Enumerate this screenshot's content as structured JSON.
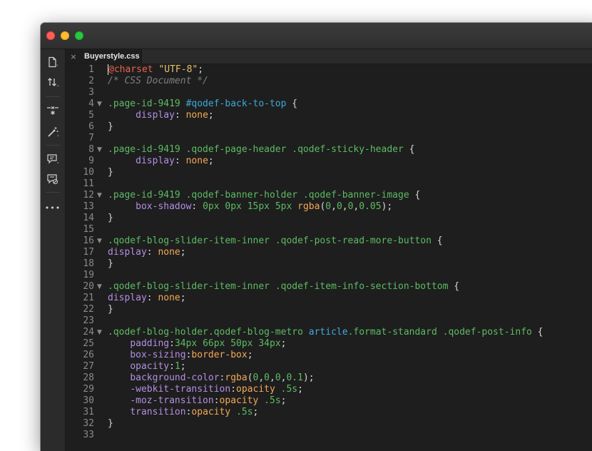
{
  "window": {
    "title": ""
  },
  "tabs": [
    {
      "label": "Buyerstyle.css",
      "active": true,
      "close_glyph": "×"
    }
  ],
  "toolbar": {
    "tools": [
      {
        "icon": "new-file-icon",
        "label": ""
      },
      {
        "icon": "file-transfer-icon",
        "label": ""
      },
      {
        "icon": "asterisk-code-icon",
        "label": ""
      },
      {
        "icon": "magic-wand-icon",
        "label": ""
      },
      {
        "icon": "comment-icon",
        "label": ""
      },
      {
        "icon": "uncomment-icon",
        "label": ""
      },
      {
        "icon": "more-icon",
        "label": "•••"
      }
    ]
  },
  "editor": {
    "lines": [
      {
        "n": "1",
        "fold": false,
        "tokens": [
          [
            "t-at",
            "@charset"
          ],
          [
            "t-p",
            " "
          ],
          [
            "t-str",
            "\"UTF-8\""
          ],
          [
            "t-p",
            ";"
          ]
        ]
      },
      {
        "n": "2",
        "fold": false,
        "tokens": [
          [
            "t-com",
            "/* CSS Document */"
          ]
        ]
      },
      {
        "n": "3",
        "fold": false,
        "tokens": []
      },
      {
        "n": "4",
        "fold": true,
        "tokens": [
          [
            "t-sel",
            ".page-id-9419"
          ],
          [
            "t-p",
            " "
          ],
          [
            "t-id",
            "#qodef-back-to-top"
          ],
          [
            "t-p",
            " {"
          ]
        ]
      },
      {
        "n": "5",
        "fold": false,
        "tokens": [
          [
            "t-p",
            "     "
          ],
          [
            "t-prop",
            "display"
          ],
          [
            "t-p",
            ": "
          ],
          [
            "t-val",
            "none"
          ],
          [
            "t-p",
            ";"
          ]
        ]
      },
      {
        "n": "6",
        "fold": false,
        "tokens": [
          [
            "t-p",
            "}"
          ]
        ]
      },
      {
        "n": "7",
        "fold": false,
        "tokens": []
      },
      {
        "n": "8",
        "fold": true,
        "tokens": [
          [
            "t-sel",
            ".page-id-9419 .qodef-page-header .qodef-sticky-header"
          ],
          [
            "t-p",
            " {"
          ]
        ]
      },
      {
        "n": "9",
        "fold": false,
        "tokens": [
          [
            "t-p",
            "     "
          ],
          [
            "t-prop",
            "display"
          ],
          [
            "t-p",
            ": "
          ],
          [
            "t-val",
            "none"
          ],
          [
            "t-p",
            ";"
          ]
        ]
      },
      {
        "n": "10",
        "fold": false,
        "tokens": [
          [
            "t-p",
            "}"
          ]
        ]
      },
      {
        "n": "11",
        "fold": false,
        "tokens": []
      },
      {
        "n": "12",
        "fold": true,
        "tokens": [
          [
            "t-sel",
            ".page-id-9419 .qodef-banner-holder .qodef-banner-image"
          ],
          [
            "t-p",
            " {"
          ]
        ]
      },
      {
        "n": "13",
        "fold": false,
        "tokens": [
          [
            "t-p",
            "     "
          ],
          [
            "t-prop",
            "box-shadow"
          ],
          [
            "t-p",
            ": "
          ],
          [
            "t-num",
            "0px 0px 15px 5px"
          ],
          [
            "t-p",
            " "
          ],
          [
            "t-fn",
            "rgba"
          ],
          [
            "t-p",
            "("
          ],
          [
            "t-num",
            "0"
          ],
          [
            "t-p",
            ","
          ],
          [
            "t-num",
            "0"
          ],
          [
            "t-p",
            ","
          ],
          [
            "t-num",
            "0"
          ],
          [
            "t-p",
            ","
          ],
          [
            "t-num",
            "0.05"
          ],
          [
            "t-p",
            ");"
          ]
        ]
      },
      {
        "n": "14",
        "fold": false,
        "tokens": [
          [
            "t-p",
            "}"
          ]
        ]
      },
      {
        "n": "15",
        "fold": false,
        "tokens": []
      },
      {
        "n": "16",
        "fold": true,
        "tokens": [
          [
            "t-sel",
            ".qodef-blog-slider-item-inner .qodef-post-read-more-button"
          ],
          [
            "t-p",
            " {"
          ]
        ]
      },
      {
        "n": "17",
        "fold": false,
        "tokens": [
          [
            "t-prop",
            "display"
          ],
          [
            "t-p",
            ": "
          ],
          [
            "t-val",
            "none"
          ],
          [
            "t-p",
            ";"
          ]
        ]
      },
      {
        "n": "18",
        "fold": false,
        "tokens": [
          [
            "t-p",
            "}"
          ]
        ]
      },
      {
        "n": "19",
        "fold": false,
        "tokens": []
      },
      {
        "n": "20",
        "fold": true,
        "tokens": [
          [
            "t-sel",
            ".qodef-blog-slider-item-inner .qodef-item-info-section-bottom"
          ],
          [
            "t-p",
            " {"
          ]
        ]
      },
      {
        "n": "21",
        "fold": false,
        "tokens": [
          [
            "t-prop",
            "display"
          ],
          [
            "t-p",
            ": "
          ],
          [
            "t-val",
            "none"
          ],
          [
            "t-p",
            ";"
          ]
        ]
      },
      {
        "n": "22",
        "fold": false,
        "tokens": [
          [
            "t-p",
            "}"
          ]
        ]
      },
      {
        "n": "23",
        "fold": false,
        "tokens": []
      },
      {
        "n": "24",
        "fold": true,
        "tokens": [
          [
            "t-sel",
            ".qodef-blog-holder.qodef-blog-metro"
          ],
          [
            "t-p",
            " "
          ],
          [
            "t-tag",
            "article"
          ],
          [
            "t-sel",
            ".format-standard .qodef-post-info"
          ],
          [
            "t-p",
            " {"
          ]
        ]
      },
      {
        "n": "25",
        "fold": false,
        "tokens": [
          [
            "t-p",
            "    "
          ],
          [
            "t-prop",
            "padding"
          ],
          [
            "t-p",
            ":"
          ],
          [
            "t-num",
            "34px 66px 50px 34px"
          ],
          [
            "t-p",
            ";"
          ]
        ]
      },
      {
        "n": "26",
        "fold": false,
        "tokens": [
          [
            "t-p",
            "    "
          ],
          [
            "t-prop",
            "box-sizing"
          ],
          [
            "t-p",
            ":"
          ],
          [
            "t-val",
            "border-box"
          ],
          [
            "t-p",
            ";"
          ]
        ]
      },
      {
        "n": "27",
        "fold": false,
        "tokens": [
          [
            "t-p",
            "    "
          ],
          [
            "t-prop",
            "opacity"
          ],
          [
            "t-p",
            ":"
          ],
          [
            "t-num",
            "1"
          ],
          [
            "t-p",
            ";"
          ]
        ]
      },
      {
        "n": "28",
        "fold": false,
        "tokens": [
          [
            "t-p",
            "    "
          ],
          [
            "t-prop",
            "background-color"
          ],
          [
            "t-p",
            ":"
          ],
          [
            "t-fn",
            "rgba"
          ],
          [
            "t-p",
            "("
          ],
          [
            "t-num",
            "0"
          ],
          [
            "t-p",
            ","
          ],
          [
            "t-num",
            "0"
          ],
          [
            "t-p",
            ","
          ],
          [
            "t-num",
            "0"
          ],
          [
            "t-p",
            ","
          ],
          [
            "t-num",
            "0.1"
          ],
          [
            "t-p",
            ");"
          ]
        ]
      },
      {
        "n": "29",
        "fold": false,
        "tokens": [
          [
            "t-p",
            "    "
          ],
          [
            "t-prop",
            "-webkit-transition"
          ],
          [
            "t-p",
            ":"
          ],
          [
            "t-val",
            "opacity"
          ],
          [
            "t-p",
            " "
          ],
          [
            "t-num",
            ".5s"
          ],
          [
            "t-p",
            ";"
          ]
        ]
      },
      {
        "n": "30",
        "fold": false,
        "tokens": [
          [
            "t-p",
            "    "
          ],
          [
            "t-prop",
            "-moz-transition"
          ],
          [
            "t-p",
            ":"
          ],
          [
            "t-val",
            "opacity"
          ],
          [
            "t-p",
            " "
          ],
          [
            "t-num",
            ".5s"
          ],
          [
            "t-p",
            ";"
          ]
        ]
      },
      {
        "n": "31",
        "fold": false,
        "tokens": [
          [
            "t-p",
            "    "
          ],
          [
            "t-prop",
            "transition"
          ],
          [
            "t-p",
            ":"
          ],
          [
            "t-val",
            "opacity"
          ],
          [
            "t-p",
            " "
          ],
          [
            "t-num",
            ".5s"
          ],
          [
            "t-p",
            ";"
          ]
        ]
      },
      {
        "n": "32",
        "fold": false,
        "tokens": [
          [
            "t-p",
            "}"
          ]
        ]
      },
      {
        "n": "33",
        "fold": false,
        "tokens": []
      }
    ]
  },
  "colors": {
    "background": "#1e1e1e",
    "selector": "#5dbb63",
    "property": "#b38fe3",
    "value": "#f3a955",
    "string": "#e6c069",
    "at_rule": "#e8644b",
    "comment": "#7f7f7f",
    "id": "#3da8d8"
  }
}
